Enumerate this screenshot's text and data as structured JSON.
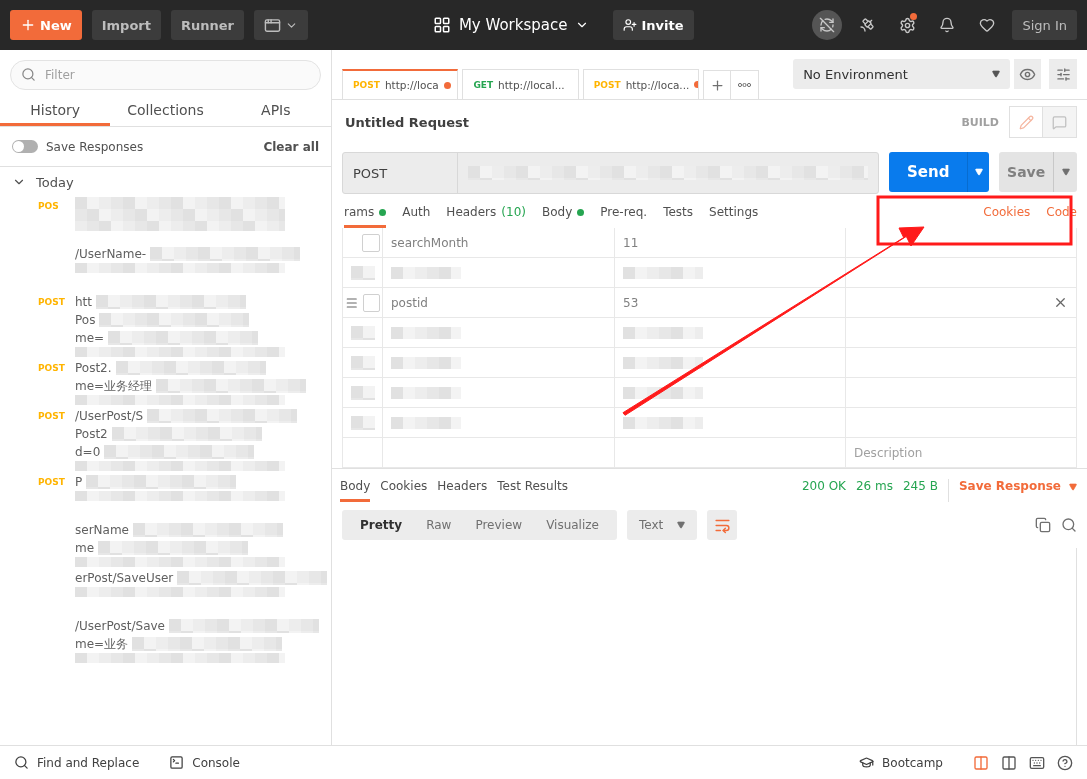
{
  "topbar": {
    "new_button": "New",
    "buttons": [
      "Import",
      "Runner"
    ],
    "workspace": "My Workspace",
    "invite": "Invite",
    "sign_in": "Sign In",
    "settings_badge": true
  },
  "sidebar": {
    "filter_placeholder": "Filter",
    "tabs": [
      {
        "label": "History",
        "selected": true
      },
      {
        "label": "Collections",
        "selected": false
      },
      {
        "label": "APIs",
        "selected": false
      }
    ],
    "save_responses": {
      "label": "Save Responses",
      "on": false
    },
    "clear_all": "Clear all",
    "group": {
      "label": "Today",
      "expanded": true
    },
    "items": [
      {
        "method": "POS"
      },
      {
        "lines": [
          "/UserName-"
        ]
      },
      {
        "method": "POST",
        "lines": [
          "htt",
          "Pos",
          "me="
        ]
      },
      {
        "method": "POST",
        "lines": [
          "Post2.",
          "me=业务经理"
        ]
      },
      {
        "method": "POST",
        "lines": [
          "/UserPost/S",
          "Post2",
          "d=0"
        ]
      },
      {
        "method": "POST",
        "lines": [
          "P"
        ]
      },
      {
        "lines": [
          "serName",
          "me"
        ]
      },
      {
        "lines": [
          "erPost/SaveUser"
        ]
      },
      {
        "lines": [
          "/UserPost/Save",
          "me=业务"
        ]
      }
    ]
  },
  "request_tabs": [
    {
      "method": "POST",
      "url": "http://loca",
      "unsaved": true,
      "selected": true
    },
    {
      "method": "GET",
      "url": "http://local...",
      "unsaved": false,
      "selected": false
    },
    {
      "method": "POST",
      "url": "http://loca...",
      "unsaved": true,
      "selected": false
    }
  ],
  "environment": "No Environment",
  "request": {
    "title": "Untitled Request",
    "build": "BUILD",
    "method": "POST",
    "send": "Send",
    "save": "Save"
  },
  "request_sections": [
    {
      "label": "rams",
      "dot": true,
      "selected": true
    },
    {
      "label": "Auth",
      "selected": false
    },
    {
      "label": "Headers",
      "count": "(10)",
      "selected": false
    },
    {
      "label": "Body",
      "dot": true,
      "selected": false
    },
    {
      "label": "Pre-req.",
      "selected": false
    },
    {
      "label": "Tests",
      "selected": false
    },
    {
      "label": "Settings",
      "selected": false
    }
  ],
  "request_links": [
    "Cookies",
    "Code"
  ],
  "params": [
    {
      "kind": "param",
      "key": "searchMonth",
      "value": "11",
      "checked": false,
      "hovered": false
    },
    {
      "kind": "redacted"
    },
    {
      "kind": "param",
      "key": "postid",
      "value": "53",
      "checked": false,
      "hovered": true
    },
    {
      "kind": "redacted"
    },
    {
      "kind": "redacted"
    },
    {
      "kind": "redacted"
    },
    {
      "kind": "redacted"
    },
    {
      "kind": "new",
      "placeholder": "Description"
    }
  ],
  "response": {
    "tabs": [
      {
        "label": "Body",
        "selected": true
      },
      {
        "label": "Cookies",
        "selected": false
      },
      {
        "label": "Headers",
        "selected": false
      },
      {
        "label": "Test Results",
        "selected": false
      }
    ],
    "status": "200 OK",
    "time": "26 ms",
    "size": "245 B",
    "save": "Save Response",
    "formats": [
      {
        "label": "Pretty",
        "selected": true
      },
      {
        "label": "Raw",
        "selected": false
      },
      {
        "label": "Preview",
        "selected": false
      },
      {
        "label": "Visualize",
        "selected": false
      }
    ],
    "type": "Text",
    "wrap": true
  },
  "status_bar": {
    "left": [
      "Find and Replace",
      "Console"
    ],
    "bootcamp": "Bootcamp"
  }
}
